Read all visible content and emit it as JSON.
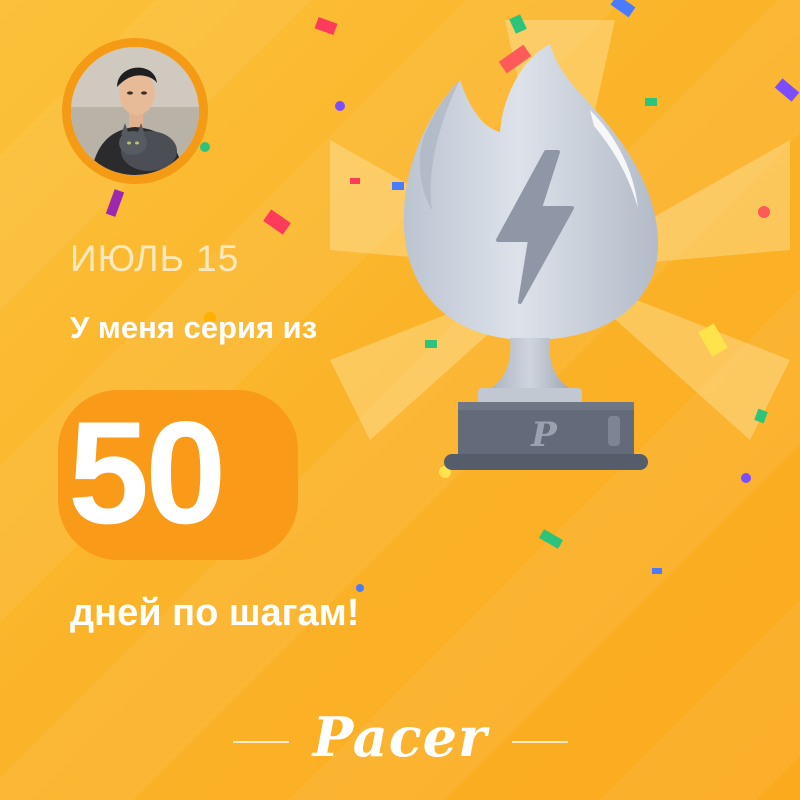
{
  "header": {
    "date_label": "ИЮЛЬ 15"
  },
  "streak": {
    "intro_text": "У меня серия из",
    "days_count": "50",
    "outro_text": "дней по шагам!"
  },
  "trophy": {
    "badge_letter": "P",
    "icon": "lightning-icon"
  },
  "brand": {
    "name": "Pacer"
  },
  "colors": {
    "background": "#fbb42a",
    "number_badge": "#f99a18",
    "trophy_silver": "#c9d0dc",
    "trophy_base": "#5e6675",
    "text": "#ffffff"
  }
}
